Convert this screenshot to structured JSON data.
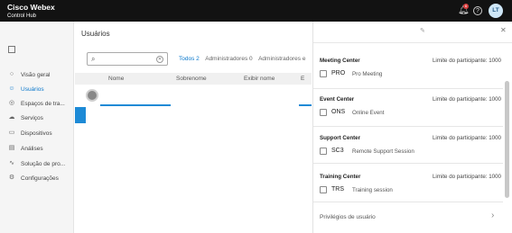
{
  "app": {
    "brand_line1": "Cisco Webex",
    "brand_line2": "Control Hub"
  },
  "topbar": {
    "notification_count": "6",
    "help_label": "?",
    "avatar_initials": "LT"
  },
  "sidebar": {
    "items": [
      {
        "label": "Visão geral",
        "icon": "overview-icon"
      },
      {
        "label": "Usuários",
        "icon": "user-icon",
        "active": true
      },
      {
        "label": "Espaços de tra...",
        "icon": "location-icon"
      },
      {
        "label": "Serviços",
        "icon": "cloud-icon"
      },
      {
        "label": "Dispositivos",
        "icon": "device-icon"
      },
      {
        "label": "Análises",
        "icon": "analytics-icon"
      },
      {
        "label": "Solução de pro...",
        "icon": "troubleshoot-icon"
      },
      {
        "label": "Configurações",
        "icon": "gear-icon"
      }
    ]
  },
  "main": {
    "title": "Usuários",
    "search": {
      "placeholder": "",
      "value": ""
    },
    "filters": [
      {
        "label": "Todos 2",
        "active": true
      },
      {
        "label": "Administradores 0",
        "active": false
      },
      {
        "label": "Administradores e",
        "active": false
      }
    ],
    "columns": [
      "Nome",
      "Sobrenome",
      "Exibir nome",
      "E"
    ]
  },
  "panel": {
    "sections": [
      {
        "title": "Meeting Center",
        "limit": "Limite do participante: 1000",
        "code": "PRO",
        "name": "Pro Meeting"
      },
      {
        "title": "Event Center",
        "limit": "Limite do participante: 1000",
        "code": "ONS",
        "name": "Online Event"
      },
      {
        "title": "Support Center",
        "limit": "Limite do participante: 1000",
        "code": "SC3",
        "name": "Remote Support Session"
      },
      {
        "title": "Training Center",
        "limit": "Limite do participante: 1000",
        "code": "TRS",
        "name": "Training session"
      }
    ],
    "privileges_label": "Privilégios de usuário"
  },
  "colors": {
    "topbar": "#121212",
    "accent": "#1d8ad6",
    "link": "#0a78cc",
    "badge": "#d93f3f"
  }
}
